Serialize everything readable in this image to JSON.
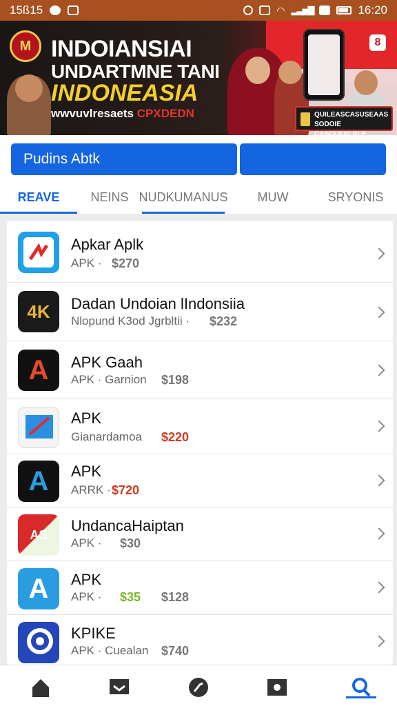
{
  "status_bar": {
    "time_left": "15ß15",
    "time_right": "16:20"
  },
  "banner": {
    "title_line1": "INDOIANSIAI",
    "title_line2": "UNDARTMNE TANI",
    "title_line3": "INDONEASIA",
    "url_text": "wwvuvlresaets",
    "url_accent": "CPXDEDN",
    "badge_text": "QUILEASCASUSEAAS SODOIE CASCLKALALE",
    "logo_text": "M",
    "close_label": "8"
  },
  "search": {
    "label": "Pudins Abtk"
  },
  "tabs": [
    {
      "label": "REAVE",
      "active": true
    },
    {
      "label": "NEINS",
      "active": false
    },
    {
      "label": "NUDKUMANUS",
      "active": false,
      "underlined": true
    },
    {
      "label": "MUW",
      "active": false
    },
    {
      "label": "SRYONIS",
      "active": false
    }
  ],
  "apps": [
    {
      "name": "Apkar Aplk",
      "sub": "APK ·",
      "price": "$270",
      "price_color": "#777777",
      "icon": "apkar-icon",
      "icon_text": "",
      "icon_bg": "#1fa0e8"
    },
    {
      "name": "Dadan Undoian lIndonsiia",
      "sub": "Nlopund K3od Jgrbltii ·",
      "price": "$232",
      "price_color": "#777777",
      "icon": "4k-icon",
      "icon_text": "4K",
      "icon_bg": "#1a1a1a"
    },
    {
      "name": "APK Gaah",
      "sub": "APK · Garnion",
      "price": "$198",
      "price_color": "#777777",
      "icon": "apk-gaah-icon",
      "icon_text": "A",
      "icon_bg": "#111111"
    },
    {
      "name": "APK",
      "sub": "Gianardamoa",
      "price": "$220",
      "price_color": "#d23a1f",
      "icon": "document-icon",
      "icon_text": "",
      "icon_bg": "#f4f4f4"
    },
    {
      "name": "APK",
      "sub": "ARRK ·",
      "price": "$720",
      "price_color": "#d23a1f",
      "icon": "apk-a-icon",
      "icon_text": "A",
      "icon_bg": "#111111"
    },
    {
      "name": "UndancaHaiptan",
      "sub": "APK ·",
      "price": "$30",
      "price_color": "#777777",
      "icon": "undanca-icon",
      "icon_text": "AS",
      "icon_bg": "#d82a2a"
    },
    {
      "name": "APK",
      "sub": "APK ·",
      "price": "$128",
      "price_color": "#777777",
      "extra_price": "$35",
      "extra_color": "#7ab826",
      "icon": "apk-blue-icon",
      "icon_text": "A",
      "icon_bg": "#2a9de0"
    },
    {
      "name": "KPIKE",
      "sub": "APK · Cuealan",
      "price": "$740",
      "price_color": "#777777",
      "icon": "kpike-icon",
      "icon_text": "",
      "icon_bg": "#2546b8"
    }
  ],
  "bottom_nav": [
    {
      "name": "home",
      "icon": "home-icon"
    },
    {
      "name": "inbox",
      "icon": "inbox-icon"
    },
    {
      "name": "explore",
      "icon": "compass-icon"
    },
    {
      "name": "favorites",
      "icon": "heart-tag-icon"
    },
    {
      "name": "search",
      "icon": "search-icon",
      "active": true
    }
  ],
  "colors": {
    "accent": "#1565e0",
    "status_bar": "#a8501f",
    "banner_yellow": "#f3cf2a",
    "banner_red": "#c01c24"
  }
}
